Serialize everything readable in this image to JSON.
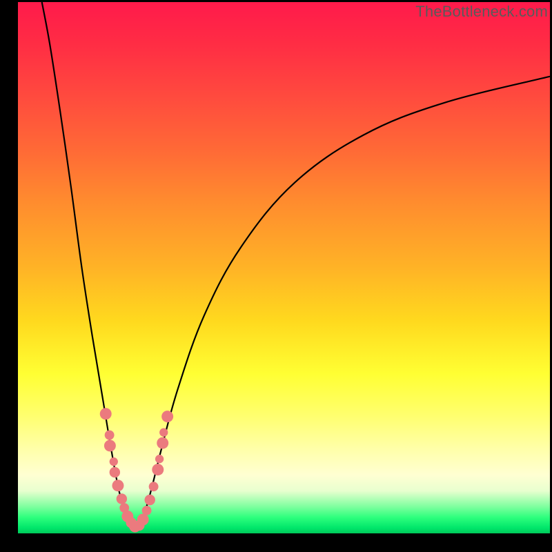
{
  "watermark": "TheBottleneck.com",
  "chart_data": {
    "type": "line",
    "title": "",
    "xlabel": "",
    "ylabel": "",
    "xlim": [
      0,
      100
    ],
    "ylim": [
      0,
      100
    ],
    "grid": false,
    "series": [
      {
        "name": "left-curve",
        "points": [
          {
            "x": 4.5,
            "y": 100
          },
          {
            "x": 6,
            "y": 92
          },
          {
            "x": 8,
            "y": 79
          },
          {
            "x": 10,
            "y": 65
          },
          {
            "x": 12,
            "y": 50
          },
          {
            "x": 14,
            "y": 37
          },
          {
            "x": 16,
            "y": 25
          },
          {
            "x": 17.5,
            "y": 16
          },
          {
            "x": 19,
            "y": 8
          },
          {
            "x": 20.5,
            "y": 3
          },
          {
            "x": 22,
            "y": 0.5
          }
        ]
      },
      {
        "name": "right-curve",
        "points": [
          {
            "x": 22,
            "y": 0.5
          },
          {
            "x": 23.5,
            "y": 3
          },
          {
            "x": 25,
            "y": 8
          },
          {
            "x": 27,
            "y": 16
          },
          {
            "x": 30,
            "y": 27
          },
          {
            "x": 35,
            "y": 41
          },
          {
            "x": 42,
            "y": 54
          },
          {
            "x": 52,
            "y": 66
          },
          {
            "x": 65,
            "y": 75
          },
          {
            "x": 80,
            "y": 81
          },
          {
            "x": 100,
            "y": 86
          }
        ]
      }
    ],
    "markers": {
      "name": "highlighted-points",
      "color": "#eb7a7e",
      "points": [
        {
          "x": 16.5,
          "y": 22.5,
          "r": 1.1
        },
        {
          "x": 17.2,
          "y": 18.5,
          "r": 0.9
        },
        {
          "x": 17.3,
          "y": 16.5,
          "r": 1.1
        },
        {
          "x": 18.0,
          "y": 13.5,
          "r": 0.8
        },
        {
          "x": 18.2,
          "y": 11.5,
          "r": 1.0
        },
        {
          "x": 18.8,
          "y": 9.0,
          "r": 1.1
        },
        {
          "x": 19.5,
          "y": 6.5,
          "r": 1.0
        },
        {
          "x": 20.0,
          "y": 4.8,
          "r": 0.9
        },
        {
          "x": 20.6,
          "y": 3.2,
          "r": 1.1
        },
        {
          "x": 21.3,
          "y": 2.0,
          "r": 1.0
        },
        {
          "x": 22.0,
          "y": 1.3,
          "r": 1.1
        },
        {
          "x": 22.8,
          "y": 1.5,
          "r": 1.0
        },
        {
          "x": 23.5,
          "y": 2.6,
          "r": 1.1
        },
        {
          "x": 24.2,
          "y": 4.3,
          "r": 0.9
        },
        {
          "x": 24.8,
          "y": 6.3,
          "r": 1.0
        },
        {
          "x": 25.5,
          "y": 8.8,
          "r": 0.9
        },
        {
          "x": 26.3,
          "y": 12.0,
          "r": 1.1
        },
        {
          "x": 26.6,
          "y": 14.0,
          "r": 0.8
        },
        {
          "x": 27.2,
          "y": 17.0,
          "r": 1.1
        },
        {
          "x": 27.4,
          "y": 19.0,
          "r": 0.8
        },
        {
          "x": 28.1,
          "y": 22.0,
          "r": 1.1
        }
      ]
    }
  }
}
